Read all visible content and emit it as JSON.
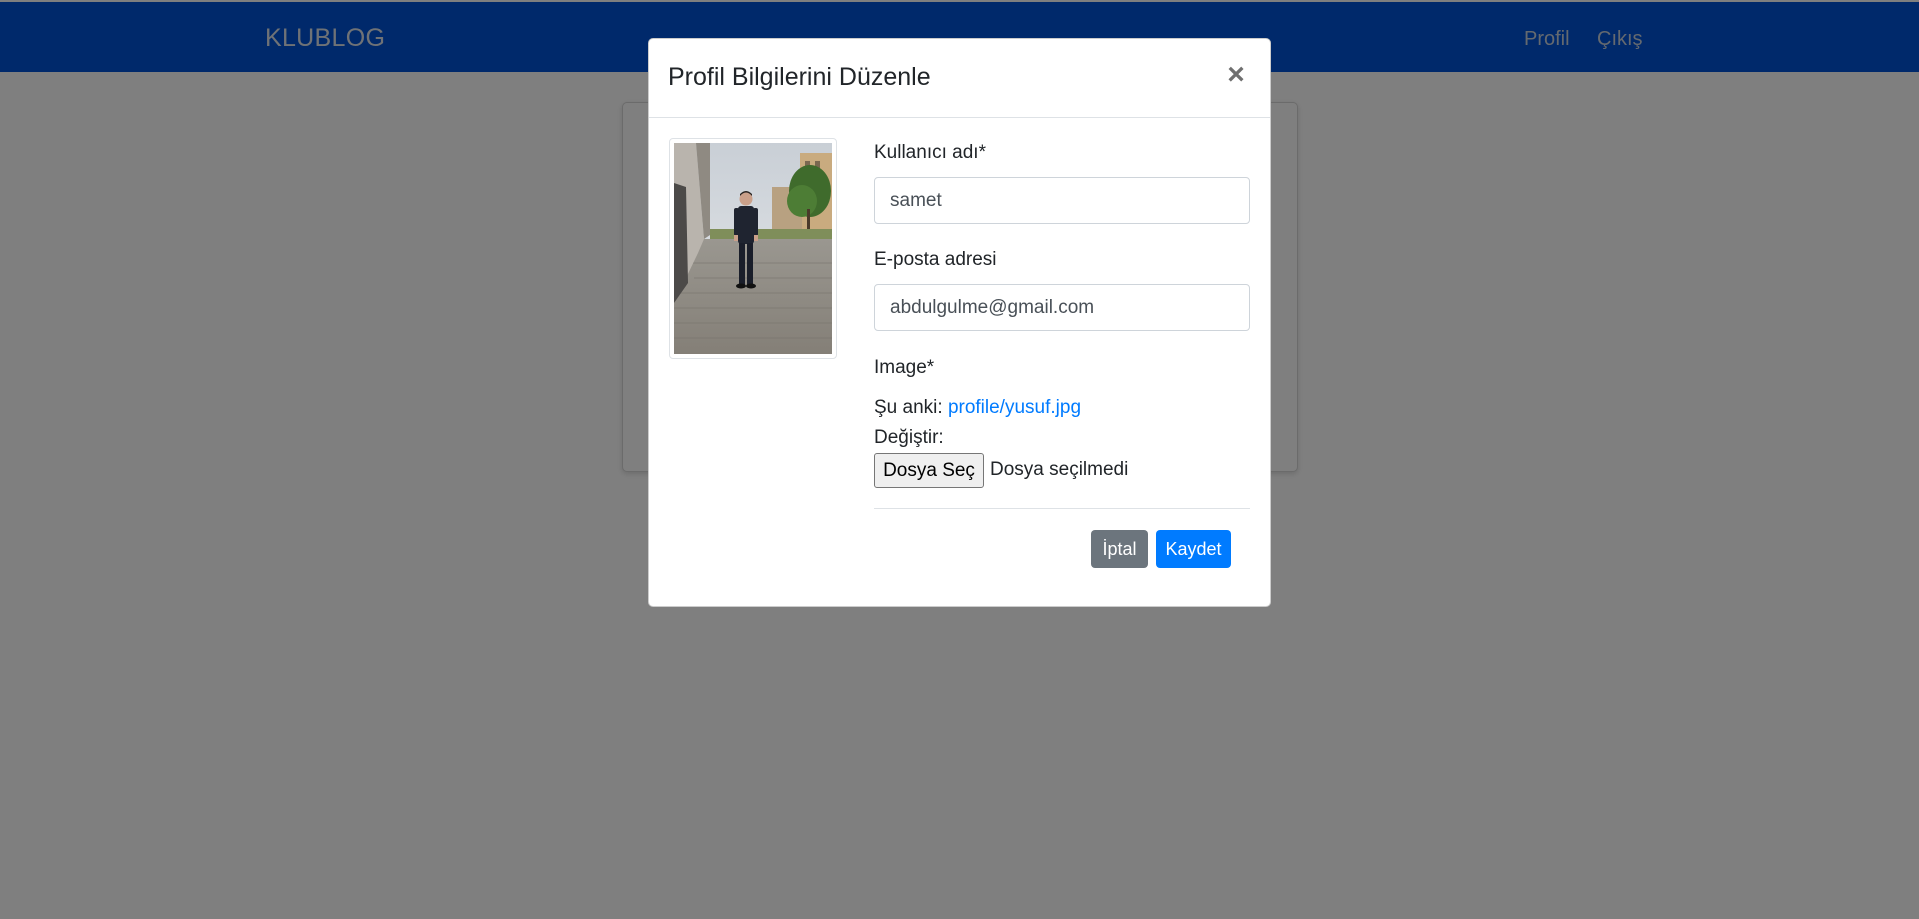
{
  "navbar": {
    "brand": "KLUBLOG",
    "links": [
      "Profil",
      "Çıkış"
    ]
  },
  "modal": {
    "title": "Profil Bilgilerini Düzenle",
    "close_symbol": "×",
    "photo_icon": "profile-photo-icon",
    "form": {
      "username": {
        "label": "Kullanıcı adı*",
        "value": "samet"
      },
      "email": {
        "label": "E-posta adresi",
        "value": "abdulgulme@gmail.com"
      },
      "image": {
        "label": "Image*",
        "current_prefix": "Şu anki:",
        "current_file": "profile/yusuf.jpg",
        "change_label": "Değiştir:",
        "choose_button": "Dosya Seç",
        "no_file_text": "Dosya seçilmedi"
      }
    },
    "buttons": {
      "cancel": "İptal",
      "save": "Kaydet"
    }
  },
  "colors": {
    "navbar": "#0053d6",
    "primary": "#007bff",
    "secondary": "#6c757d",
    "link": "#007bff"
  }
}
